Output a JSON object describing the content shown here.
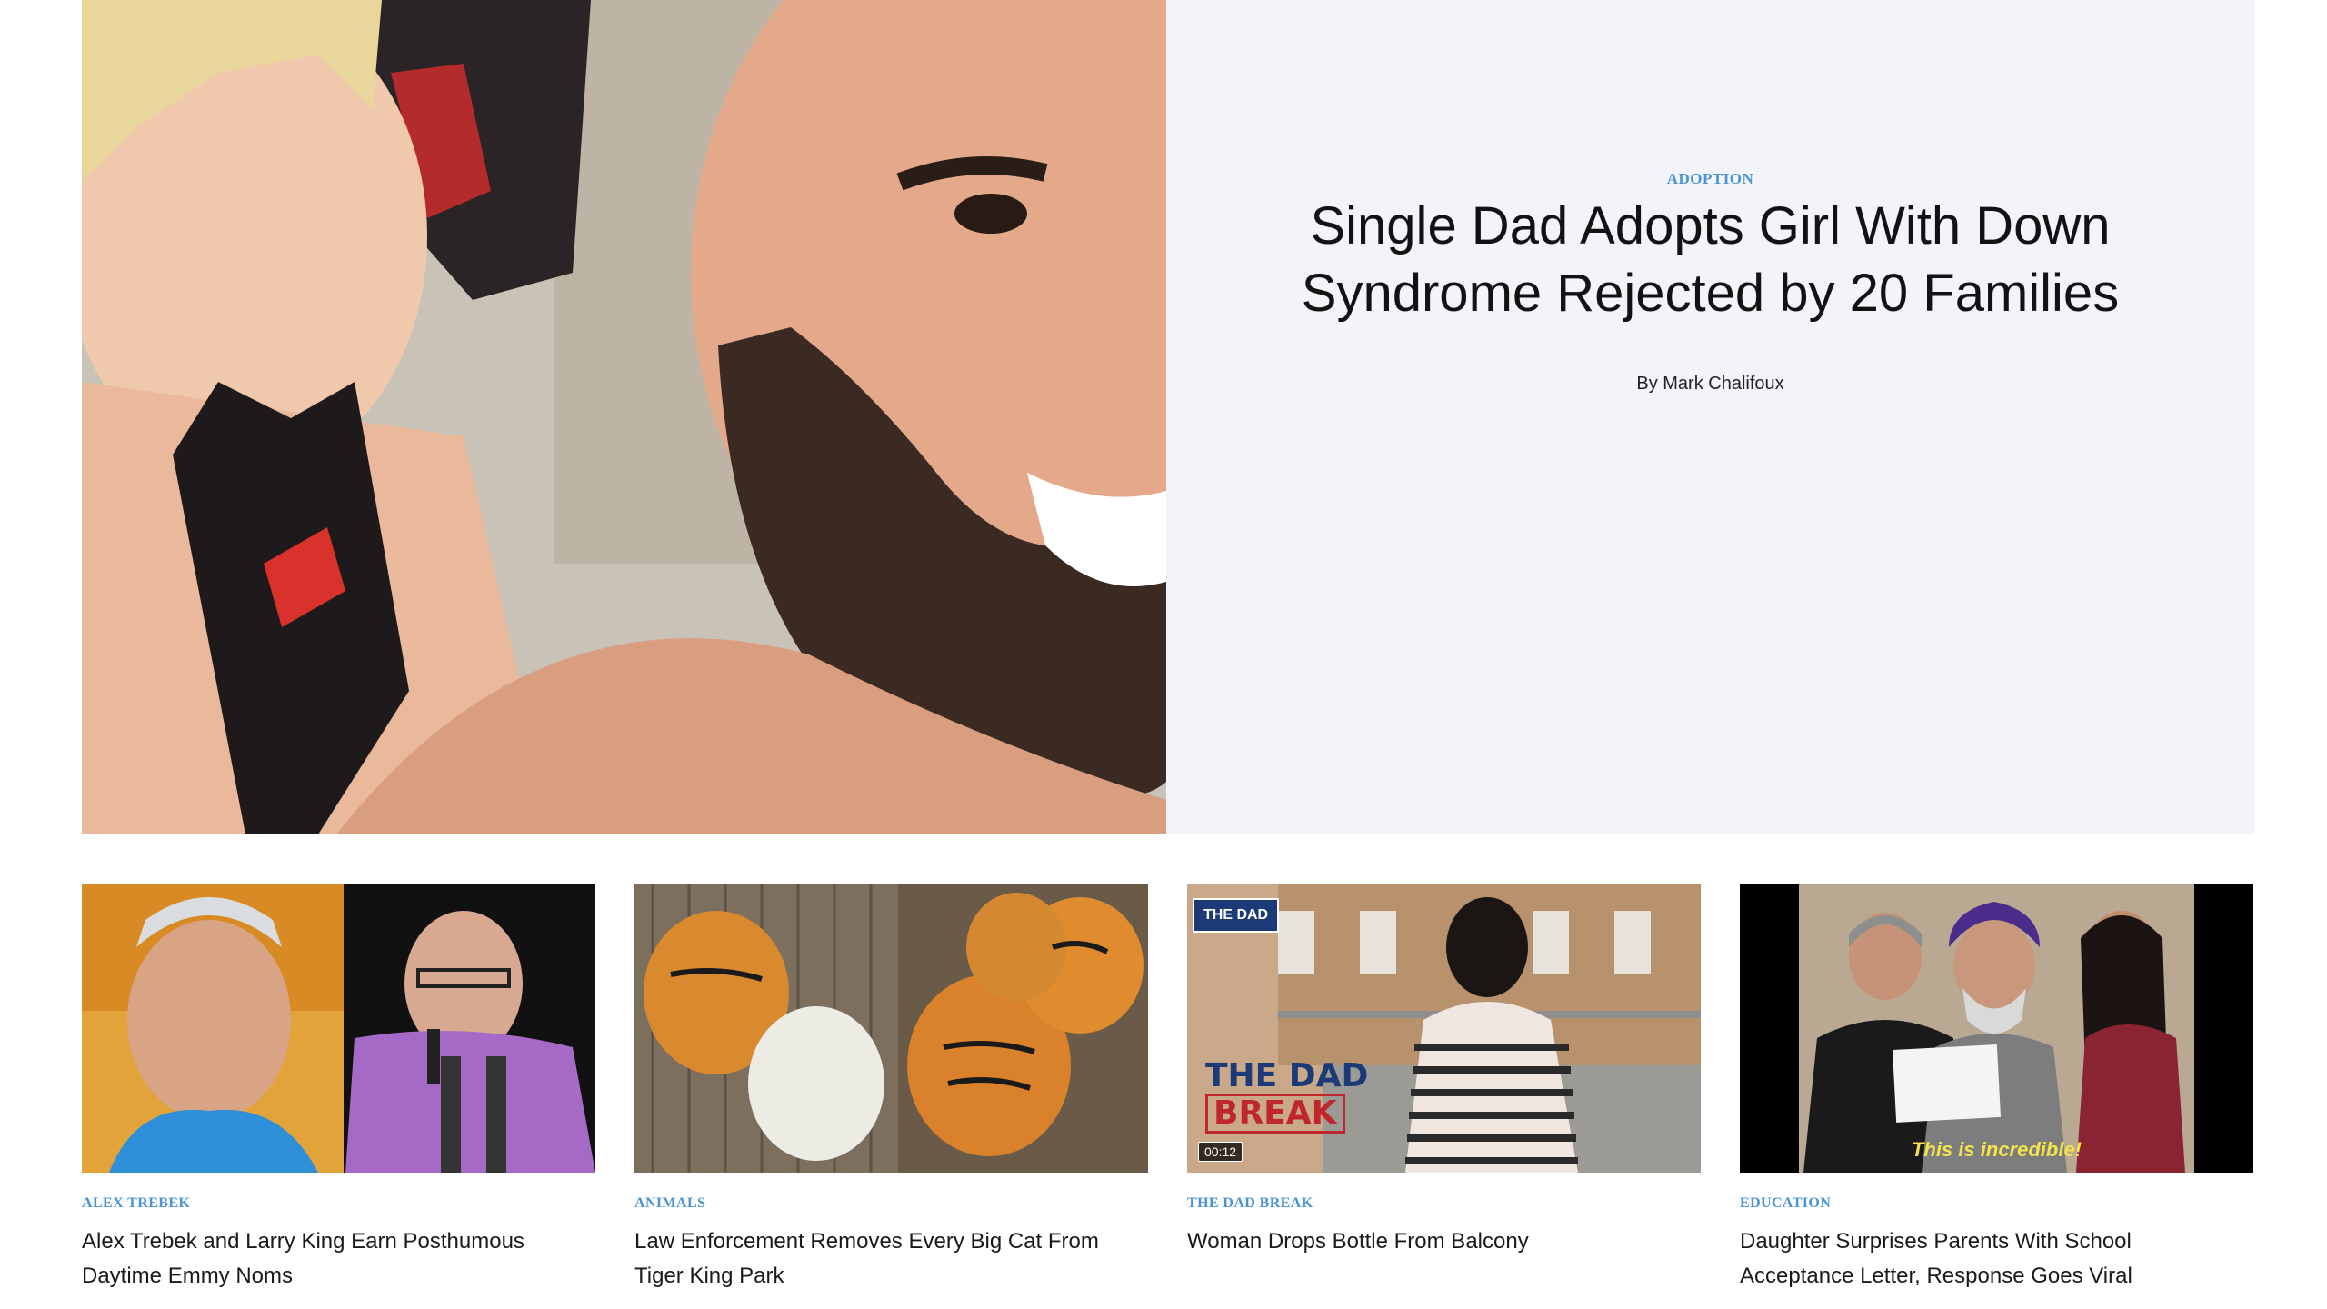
{
  "hero": {
    "category": "ADOPTION",
    "title": "Single Dad Adopts Girl With Down Syndrome Rejected by 20 Families",
    "byline": "By Mark Chalifoux"
  },
  "cards": [
    {
      "category": "ALEX TREBEK",
      "title": "Alex Trebek and Larry King Earn Posthumous Daytime Emmy Noms"
    },
    {
      "category": "ANIMALS",
      "title": "Law Enforcement Removes Every Big Cat From Tiger King Park"
    },
    {
      "category": "THE DAD BREAK",
      "title": "Woman Drops Bottle From Balcony",
      "video_duration": "00:12",
      "logo_line1": "THE DAD",
      "logo_line2": "BREAK",
      "badge": "THE DAD"
    },
    {
      "category": "EDUCATION",
      "title": "Daughter Surprises Parents With School Acceptance Letter, Response Goes Viral",
      "caption": "This is incredible!"
    }
  ],
  "colors": {
    "category_blue": "#4a93d4",
    "hero_panel_bg": "#f2f4f9"
  }
}
